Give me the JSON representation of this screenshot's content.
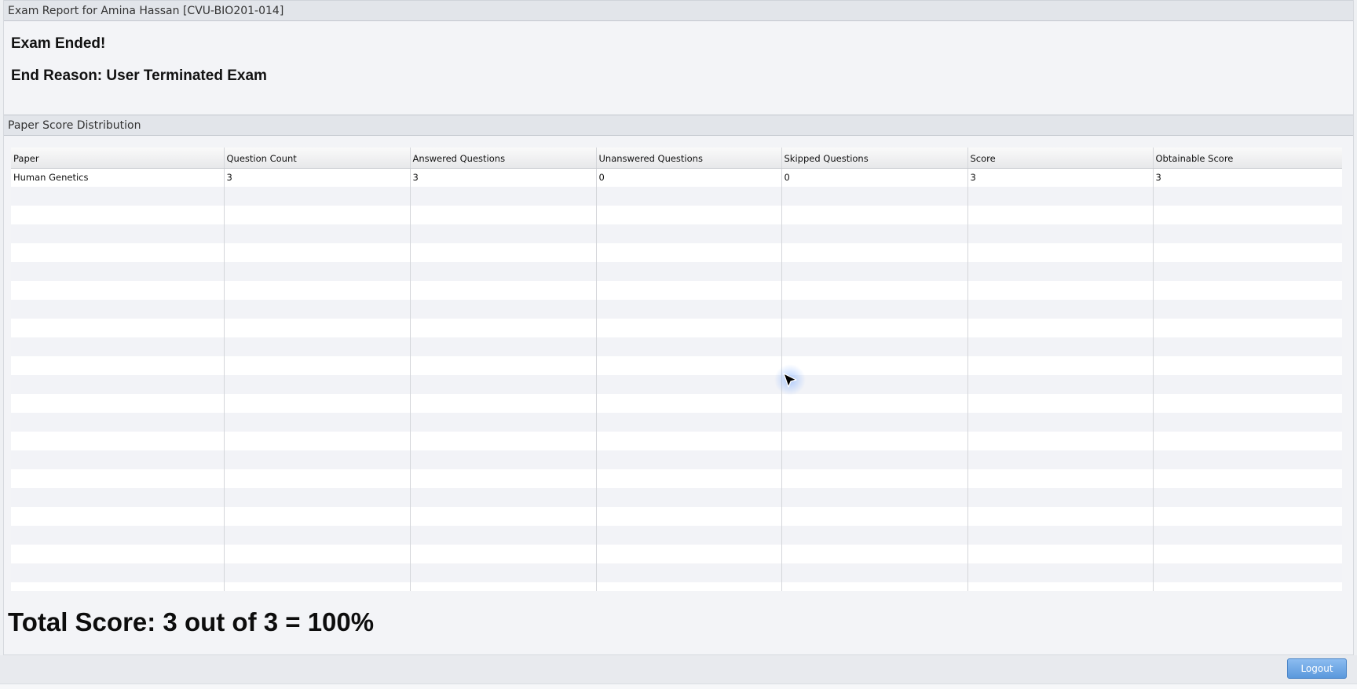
{
  "window": {
    "title": "Exam Report for Amina Hassan [CVU-BIO201-014]"
  },
  "status": {
    "ended_label": "Exam Ended!",
    "end_reason_label": "End Reason: User Terminated Exam"
  },
  "distribution": {
    "section_title": "Paper Score Distribution",
    "columns": [
      "Paper",
      "Question Count",
      "Answered Questions",
      "Unanswered Questions",
      "Skipped Questions",
      "Score",
      "Obtainable Score"
    ],
    "rows": [
      [
        "Human Genetics",
        "3",
        "3",
        "0",
        "0",
        "3",
        "3"
      ]
    ]
  },
  "summary": {
    "total_score_text": "Total Score: 3 out of 3 = 100%"
  },
  "footer": {
    "logout_label": "Logout"
  },
  "icons": {
    "cursor": "mouse-pointer-icon"
  }
}
